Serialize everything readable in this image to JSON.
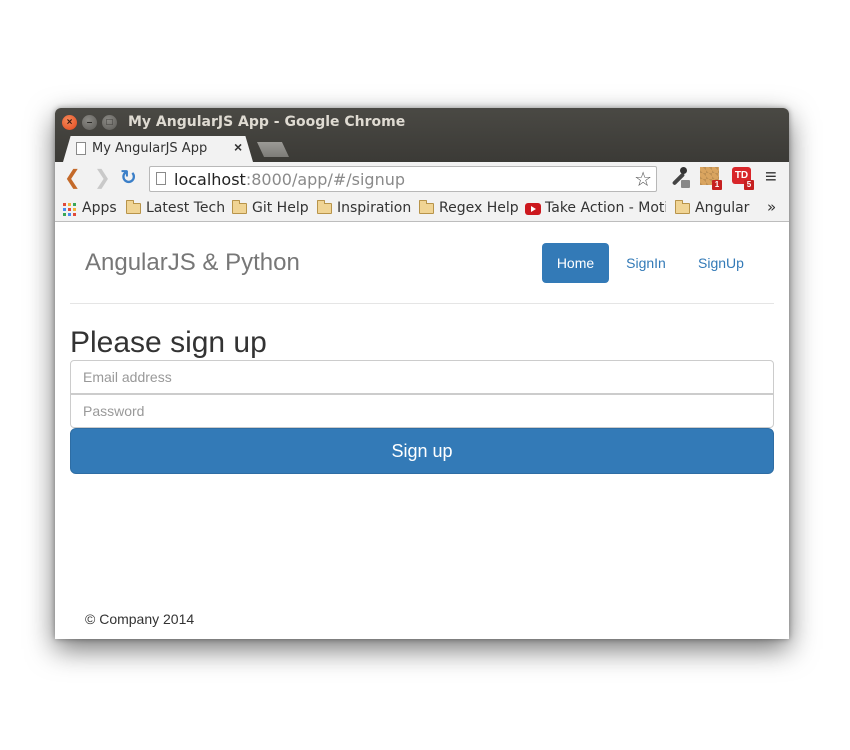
{
  "window": {
    "title": "My AngularJS App - Google Chrome",
    "controls": {
      "close": "×",
      "minimize": "–",
      "maximize": "□"
    }
  },
  "tab": {
    "title": "My AngularJS App",
    "close": "×"
  },
  "toolbar": {
    "back": "❮",
    "forward": "❯",
    "reload": "↻",
    "url_host": "localhost",
    "url_rest": ":8000/app/#/signup",
    "star": "☆",
    "menu": "≡",
    "extensions": [
      {
        "name": "eyedropper",
        "badge": ""
      },
      {
        "name": "box-extension",
        "badge": "1"
      },
      {
        "name": "td-extension",
        "label": "TD",
        "badge": "5"
      }
    ]
  },
  "bookmarks": {
    "items": [
      {
        "label": "Apps",
        "icon": "apps-icon"
      },
      {
        "label": "Latest Tech",
        "icon": "folder-icon"
      },
      {
        "label": "Git Help",
        "icon": "folder-icon"
      },
      {
        "label": "Inspiration",
        "icon": "folder-icon"
      },
      {
        "label": "Regex Help",
        "icon": "folder-icon"
      },
      {
        "label": "Take Action - Motiv",
        "icon": "youtube-icon"
      },
      {
        "label": "Angular",
        "icon": "folder-icon"
      }
    ],
    "more": "»"
  },
  "page": {
    "brand": "AngularJS & Python",
    "nav": [
      {
        "label": "Home",
        "active": true
      },
      {
        "label": "SignIn",
        "active": false
      },
      {
        "label": "SignUp",
        "active": false
      }
    ],
    "form": {
      "heading": "Please sign up",
      "email_placeholder": "Email address",
      "password_placeholder": "Password",
      "submit_label": "Sign up"
    },
    "footer": "© Company 2014"
  },
  "colors": {
    "primary": "#337ab7",
    "titlebar": "#3c3b37",
    "chrome_bg": "#f2f2f2"
  }
}
